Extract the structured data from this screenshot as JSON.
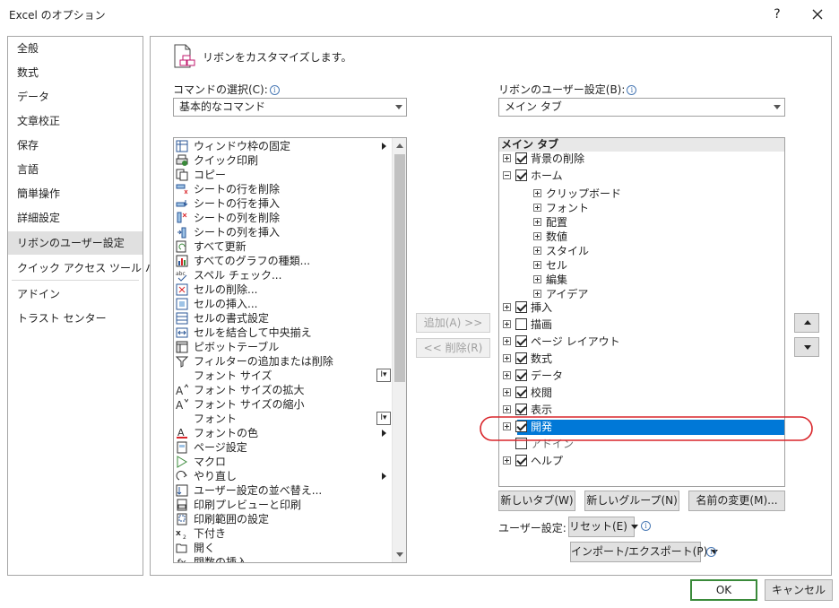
{
  "window": {
    "title": "Excel のオプション",
    "help_label": "?"
  },
  "nav": {
    "items": [
      {
        "label": "全般"
      },
      {
        "label": "数式"
      },
      {
        "label": "データ"
      },
      {
        "label": "文章校正"
      },
      {
        "label": "保存"
      },
      {
        "label": "言語"
      },
      {
        "label": "簡単操作"
      },
      {
        "label": "詳細設定"
      },
      {
        "label": "リボンのユーザー設定",
        "selected": true
      },
      {
        "label": "クイック アクセス ツール バー"
      },
      {
        "label": "アドイン"
      },
      {
        "label": "トラスト センター"
      }
    ]
  },
  "header": {
    "text": "リボンをカスタマイズします。"
  },
  "commands": {
    "label": "コマンドの選択(C):",
    "selected": "基本的なコマンド",
    "items": [
      {
        "label": "ウィンドウ枠の固定",
        "icon": "freeze-panes-icon",
        "submenu": true
      },
      {
        "label": "クイック印刷",
        "icon": "quick-print-icon"
      },
      {
        "label": "コピー",
        "icon": "copy-icon"
      },
      {
        "label": "シートの行を削除",
        "icon": "delete-row-icon"
      },
      {
        "label": "シートの行を挿入",
        "icon": "insert-row-icon"
      },
      {
        "label": "シートの列を削除",
        "icon": "delete-column-icon"
      },
      {
        "label": "シートの列を挿入",
        "icon": "insert-column-icon"
      },
      {
        "label": "すべて更新",
        "icon": "refresh-all-icon"
      },
      {
        "label": "すべてのグラフの種類...",
        "icon": "chart-types-icon"
      },
      {
        "label": "スペル チェック...",
        "icon": "spelling-icon"
      },
      {
        "label": "セルの削除...",
        "icon": "delete-cells-icon"
      },
      {
        "label": "セルの挿入...",
        "icon": "insert-cells-icon"
      },
      {
        "label": "セルの書式設定",
        "icon": "format-cells-icon"
      },
      {
        "label": "セルを結合して中央揃え",
        "icon": "merge-center-icon"
      },
      {
        "label": "ピボットテーブル",
        "icon": "pivot-table-icon"
      },
      {
        "label": "フィルターの追加または削除",
        "icon": "filter-icon"
      },
      {
        "label": "フォント サイズ",
        "icon": "",
        "picker": true
      },
      {
        "label": "フォント サイズの拡大",
        "icon": "increase-font-icon"
      },
      {
        "label": "フォント サイズの縮小",
        "icon": "decrease-font-icon"
      },
      {
        "label": "フォント",
        "icon": "",
        "picker": true
      },
      {
        "label": "フォントの色",
        "icon": "font-color-icon",
        "submenu": true
      },
      {
        "label": "ページ設定",
        "icon": "page-setup-icon"
      },
      {
        "label": "マクロ",
        "icon": "macro-icon"
      },
      {
        "label": "やり直し",
        "icon": "redo-icon",
        "submenu": true
      },
      {
        "label": "ユーザー設定の並べ替え...",
        "icon": "custom-sort-icon"
      },
      {
        "label": "印刷プレビューと印刷",
        "icon": "print-preview-icon"
      },
      {
        "label": "印刷範囲の設定",
        "icon": "print-area-icon"
      },
      {
        "label": "下付き",
        "icon": "subscript-icon"
      },
      {
        "label": "開く",
        "icon": "open-icon"
      },
      {
        "label": "関数の挿入",
        "icon": "insert-function-icon"
      }
    ]
  },
  "ribbon": {
    "label": "リボンのユーザー設定(B):",
    "selected": "メイン タブ",
    "tree_header": "メイン タブ",
    "tree": [
      {
        "label": "背景の削除",
        "level": 0,
        "expand": "plus",
        "checked": true
      },
      {
        "label": "ホーム",
        "level": 0,
        "expand": "minus",
        "checked": true
      },
      {
        "label": "クリップボード",
        "level": 1,
        "expand": "plus"
      },
      {
        "label": "フォント",
        "level": 1,
        "expand": "plus"
      },
      {
        "label": "配置",
        "level": 1,
        "expand": "plus"
      },
      {
        "label": "数値",
        "level": 1,
        "expand": "plus"
      },
      {
        "label": "スタイル",
        "level": 1,
        "expand": "plus"
      },
      {
        "label": "セル",
        "level": 1,
        "expand": "plus"
      },
      {
        "label": "編集",
        "level": 1,
        "expand": "plus"
      },
      {
        "label": "アイデア",
        "level": 1,
        "expand": "plus"
      },
      {
        "label": "挿入",
        "level": 0,
        "expand": "plus",
        "checked": true
      },
      {
        "label": "描画",
        "level": 0,
        "expand": "plus",
        "checked": false
      },
      {
        "label": "ページ レイアウト",
        "level": 0,
        "expand": "plus",
        "checked": true
      },
      {
        "label": "数式",
        "level": 0,
        "expand": "plus",
        "checked": true
      },
      {
        "label": "データ",
        "level": 0,
        "expand": "plus",
        "checked": true
      },
      {
        "label": "校閲",
        "level": 0,
        "expand": "plus",
        "checked": true
      },
      {
        "label": "表示",
        "level": 0,
        "expand": "plus",
        "checked": true
      },
      {
        "label": "開発",
        "level": 0,
        "expand": "plus",
        "checked": true,
        "selected": true
      },
      {
        "label": "アドイン",
        "level": 0,
        "expand": "none",
        "checked": false,
        "disabled": true
      },
      {
        "label": "ヘルプ",
        "level": 0,
        "expand": "plus",
        "checked": true
      }
    ]
  },
  "buttons": {
    "add": "追加(A) >>",
    "remove": "<< 削除(R)",
    "new_tab": "新しいタブ(W)",
    "new_group": "新しいグループ(N)",
    "rename": "名前の変更(M)...",
    "customize_label": "ユーザー設定:",
    "reset": "リセット(E)",
    "import_export": "インポート/エクスポート(P)",
    "ok": "OK",
    "cancel": "キャンセル"
  },
  "colors": {
    "selection": "#0078d7",
    "highlight_ring": "#d9252a",
    "ok_border": "#3a8a3a"
  }
}
